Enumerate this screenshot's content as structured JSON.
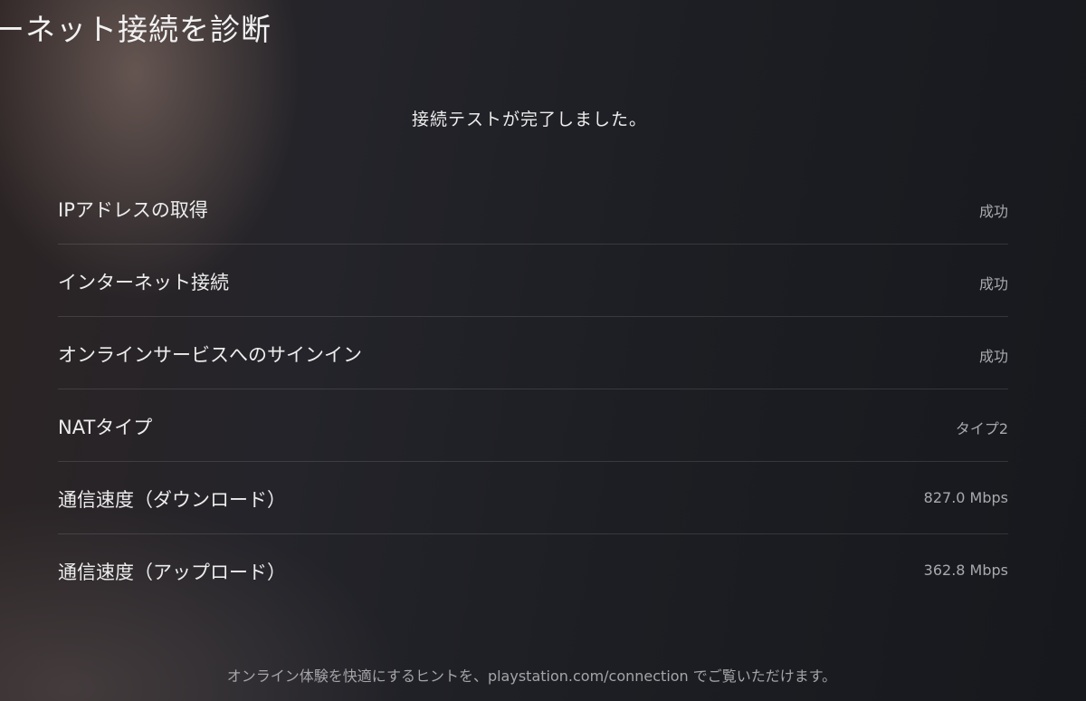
{
  "header": {
    "title": "ーネット接続を診断"
  },
  "status": {
    "message": "接続テストが完了しました。"
  },
  "results": [
    {
      "label": "IPアドレスの取得",
      "value": "成功"
    },
    {
      "label": "インターネット接続",
      "value": "成功"
    },
    {
      "label": "オンラインサービスへのサインイン",
      "value": "成功"
    },
    {
      "label": "NATタイプ",
      "value": "タイプ2"
    },
    {
      "label": "通信速度（ダウンロード）",
      "value": "827.0 Mbps"
    },
    {
      "label": "通信速度（アップロード）",
      "value": "362.8 Mbps"
    }
  ],
  "footer": {
    "hint": "オンライン体験を快適にするヒントを、playstation.com/connection でご覧いただけます。"
  }
}
